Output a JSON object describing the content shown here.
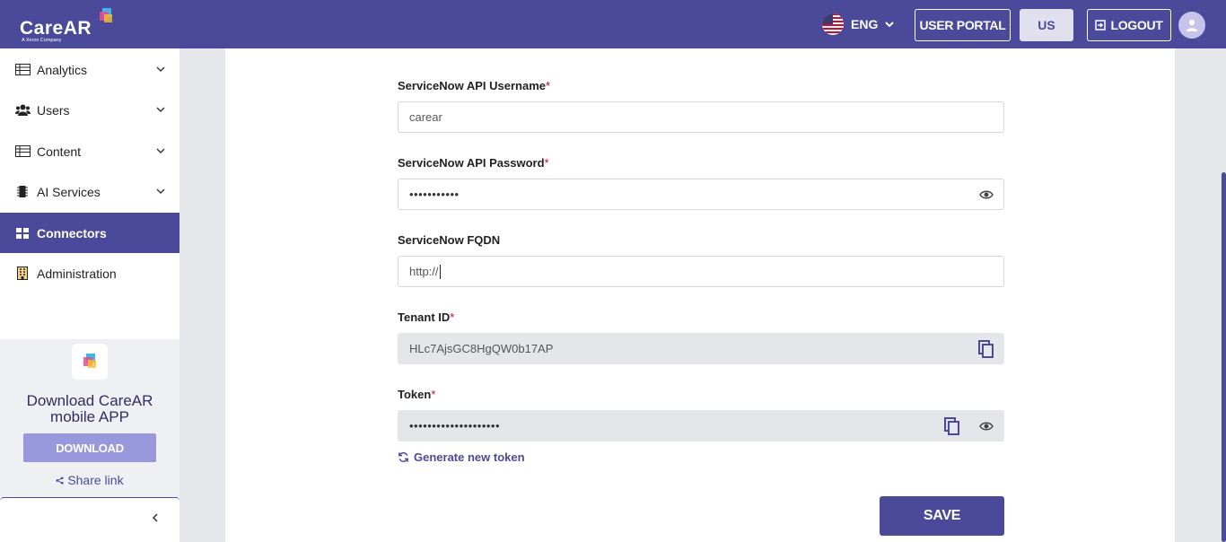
{
  "header": {
    "logo_text": "CareAR",
    "logo_sub": "A Xerox Company",
    "language": "ENG",
    "user_portal_label": "USER PORTAL",
    "region_label": "US",
    "logout_label": "LOGOUT"
  },
  "sidebar": {
    "items": [
      {
        "label": "Analytics",
        "icon": "table-icon"
      },
      {
        "label": "Users",
        "icon": "users-icon"
      },
      {
        "label": "Content",
        "icon": "table-icon"
      },
      {
        "label": "AI Services",
        "icon": "chip-icon"
      },
      {
        "label": "Connectors",
        "icon": "grid-icon"
      },
      {
        "label": "Administration",
        "icon": "building-icon"
      }
    ],
    "promo": {
      "title_line1": "Download CareAR",
      "title_line2": "mobile APP",
      "download_label": "DOWNLOAD",
      "share_label": "Share link"
    }
  },
  "form": {
    "username_label": "ServiceNow API Username",
    "username_value": "carear",
    "password_label": "ServiceNow API Password",
    "password_value": "•••••••••••",
    "fqdn_label": "ServiceNow FQDN",
    "fqdn_value": "http://",
    "tenant_label": "Tenant ID",
    "tenant_value": "HLc7AjsGC8HgQW0b17AP",
    "token_label": "Token",
    "token_value": "••••••••••••••••••••",
    "generate_label": "Generate new token",
    "save_label": "SAVE",
    "required_mark": "*"
  },
  "colors": {
    "brand": "#4b4a9a",
    "brand_light": "#9a98dc",
    "required": "#d0021b"
  }
}
